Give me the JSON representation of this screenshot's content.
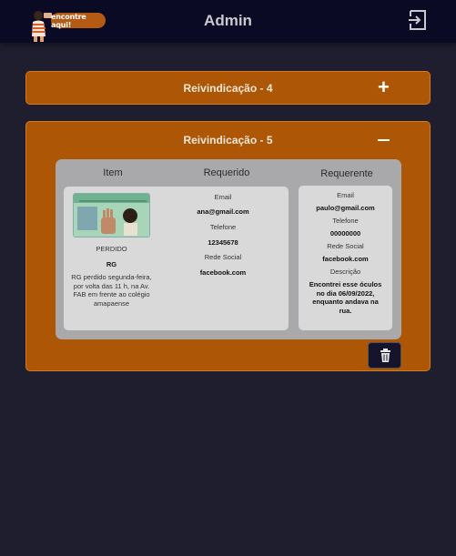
{
  "header": {
    "logo_text": "encontre aqui!",
    "title": "Admin",
    "logout_icon": "logout-icon"
  },
  "claims": [
    {
      "title": "Reivindicação - 4",
      "toggle_icon": "plus-icon",
      "expanded": false
    },
    {
      "title": "Reivindicação - 5",
      "toggle_icon": "minus-icon",
      "expanded": true
    }
  ],
  "detail": {
    "columns": {
      "item": "Item",
      "requested": "Requerido",
      "requester": "Requerente"
    },
    "item": {
      "status": "PERDIDO",
      "name": "RG",
      "description": "RG perdido segunda-feira, por volta das 11 h, na Av. FAB em frente ao colégio amapaense"
    },
    "requested": {
      "email_label": "Email",
      "email": "ana@gmail.com",
      "phone_label": "Telefone",
      "phone": "12345678",
      "social_label": "Rede Social",
      "social": "facebook.com"
    },
    "requester": {
      "email_label": "Email",
      "email": "paulo@gmail.com",
      "phone_label": "Telefone",
      "phone": "00000000",
      "social_label": "Rede Social",
      "social": "facebook.com",
      "description_label": "Descrição",
      "description": "Encontrei esse óculos no dia 06/09/2022, enquanto andava na rua."
    }
  },
  "colors": {
    "topbar": "#0b0a24",
    "background": "#1f1e2e",
    "panel": "#ad5606",
    "card": "#a9a9ab",
    "inner": "#d9d9d9"
  }
}
